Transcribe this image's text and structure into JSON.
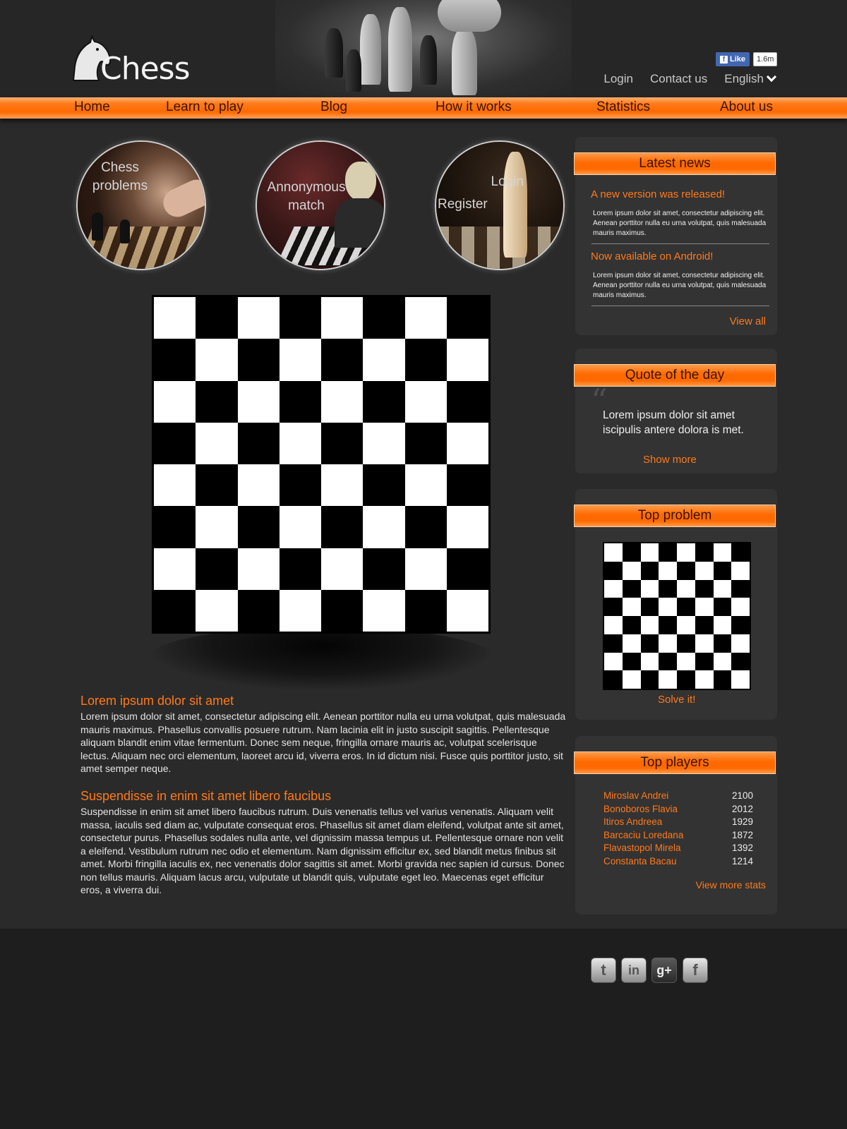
{
  "header": {
    "logo_text": "Chess",
    "fb_like_label": "Like",
    "fb_like_count": "1.6m",
    "links": {
      "login": "Login",
      "contact": "Contact us",
      "language": "English"
    }
  },
  "nav": {
    "items": [
      "Home",
      "Learn to play",
      "Blog",
      "How it works",
      "Statistics",
      "About us"
    ]
  },
  "features": {
    "chess_problems": [
      "Chess",
      "problems"
    ],
    "anonymous_match": [
      "Annonymous",
      "match"
    ],
    "login": "Login",
    "register": "Register"
  },
  "board": {
    "size": 8,
    "top_left": "white"
  },
  "articles": [
    {
      "title": "Lorem ipsum dolor sit amet",
      "body": "Lorem ipsum dolor sit amet, consectetur adipiscing elit. Aenean porttitor nulla eu urna volutpat, quis malesuada mauris maximus. Phasellus convallis posuere rutrum. Nam lacinia elit in justo suscipit sagittis. Pellentesque aliquam blandit enim vitae fermentum. Donec sem neque, fringilla ornare mauris ac, volutpat  scelerisque lectus. Aliquam nec orci elementum, laoreet arcu id, viverra eros. In id dictum nisi. Fusce quis porttitor justo, sit amet semper neque."
    },
    {
      "title": "Suspendisse in enim sit amet libero faucibus",
      "body": "Suspendisse in enim sit amet libero faucibus rutrum. Duis venenatis tellus vel varius venenatis. Aliquam velit massa, iaculis sed diam ac, vulputate consequat eros. Phasellus sit amet diam eleifend, volutpat ante  sit amet, consectetur purus. Phasellus sodales nulla ante, vel dignissim massa tempus ut. Pellentesque ornare non velit a eleifend. Vestibulum rutrum nec odio et elementum. Nam dignissim efficitur ex, sed blandit metus finibus sit amet. Morbi fringilla iaculis ex, nec venenatis dolor sagittis sit amet. Morbi gravida nec sapien id cursus. Donec non tellus mauris. Aliquam lacus arcu, vulputate ut blandit quis, vulputate eget leo. Maecenas eget efficitur eros, a viverra dui."
    }
  ],
  "sidebar": {
    "news": {
      "heading": "Latest news",
      "items": [
        {
          "title": "A new version was released!",
          "text": "Lorem ipsum dolor sit amet, consectetur adipiscing elit. Aenean porttitor nulla eu urna volutpat, quis malesuada mauris maximus."
        },
        {
          "title": "Now available on Android!",
          "text": "Lorem ipsum dolor sit amet, consectetur adipiscing elit. Aenean porttitor nulla eu urna volutpat, quis malesuada mauris maximus."
        }
      ],
      "view_all": "View all"
    },
    "quote": {
      "heading": "Quote of the day",
      "mark": "“",
      "text": "Lorem ipsum dolor sit amet iscipulis antere dolora is met.",
      "show_more": "Show more"
    },
    "problem": {
      "heading": "Top problem",
      "solve": "Solve it!"
    },
    "players": {
      "heading": "Top players",
      "list": [
        {
          "name": "Miroslav Andrei",
          "score": "2100"
        },
        {
          "name": "Bonoboros Flavia",
          "score": "2012"
        },
        {
          "name": "Itiros Andreea",
          "score": "1929"
        },
        {
          "name": "Barcaciu Loredana",
          "score": "1872"
        },
        {
          "name": "Flavastopol Mirela",
          "score": "1392"
        },
        {
          "name": "Constanta Bacau",
          "score": "1214"
        }
      ],
      "view_more": "View more stats"
    }
  },
  "footer": {
    "social": [
      {
        "icon": "twitter-icon",
        "glyph": "t"
      },
      {
        "icon": "linkedin-icon",
        "glyph": "in"
      },
      {
        "icon": "google-plus-icon",
        "glyph": "g+"
      },
      {
        "icon": "facebook-icon",
        "glyph": "f"
      }
    ]
  },
  "colors": {
    "accent": "#ff6a00",
    "background": "#2a2a2a",
    "footer": "#1e1e1e",
    "panel": "#333333"
  }
}
